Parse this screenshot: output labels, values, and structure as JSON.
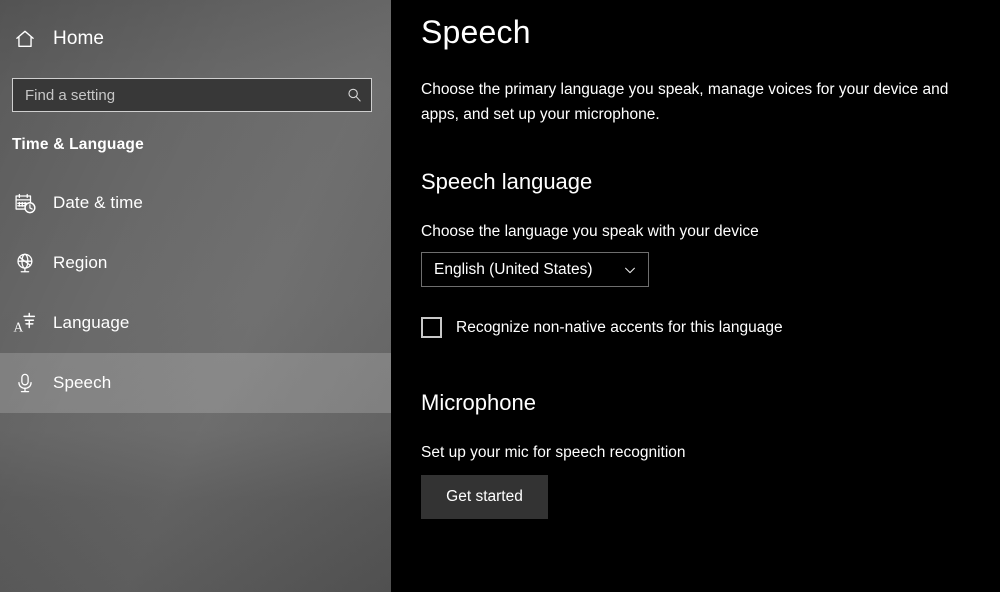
{
  "sidebar": {
    "home": {
      "label": "Home",
      "icon": "home-icon"
    },
    "search": {
      "placeholder": "Find a setting",
      "value": "",
      "icon": "search-icon"
    },
    "category_title": "Time & Language",
    "items": [
      {
        "label": "Date & time",
        "icon": "calendar-clock-icon",
        "selected": false
      },
      {
        "label": "Region",
        "icon": "globe-icon",
        "selected": false
      },
      {
        "label": "Language",
        "icon": "language-icon",
        "selected": false
      },
      {
        "label": "Speech",
        "icon": "microphone-icon",
        "selected": true
      }
    ]
  },
  "main": {
    "title": "Speech",
    "description": "Choose the primary language you speak, manage voices for your device and apps, and set up your microphone.",
    "speech_language": {
      "heading": "Speech language",
      "label": "Choose the language you speak with your device",
      "selected_option": "English (United States)",
      "chevron_icon": "chevron-down-icon",
      "checkbox_label": "Recognize non-native accents for this language",
      "checkbox_checked": false
    },
    "microphone": {
      "heading": "Microphone",
      "label": "Set up your mic for speech recognition",
      "button_label": "Get started"
    }
  },
  "colors": {
    "sidebar_bg": "#6b6b6b",
    "selected_item_bg": "#8a8a8a",
    "main_bg": "#000000",
    "text": "#ffffff",
    "button_bg": "#333333",
    "control_border": "#6e6e6e"
  }
}
